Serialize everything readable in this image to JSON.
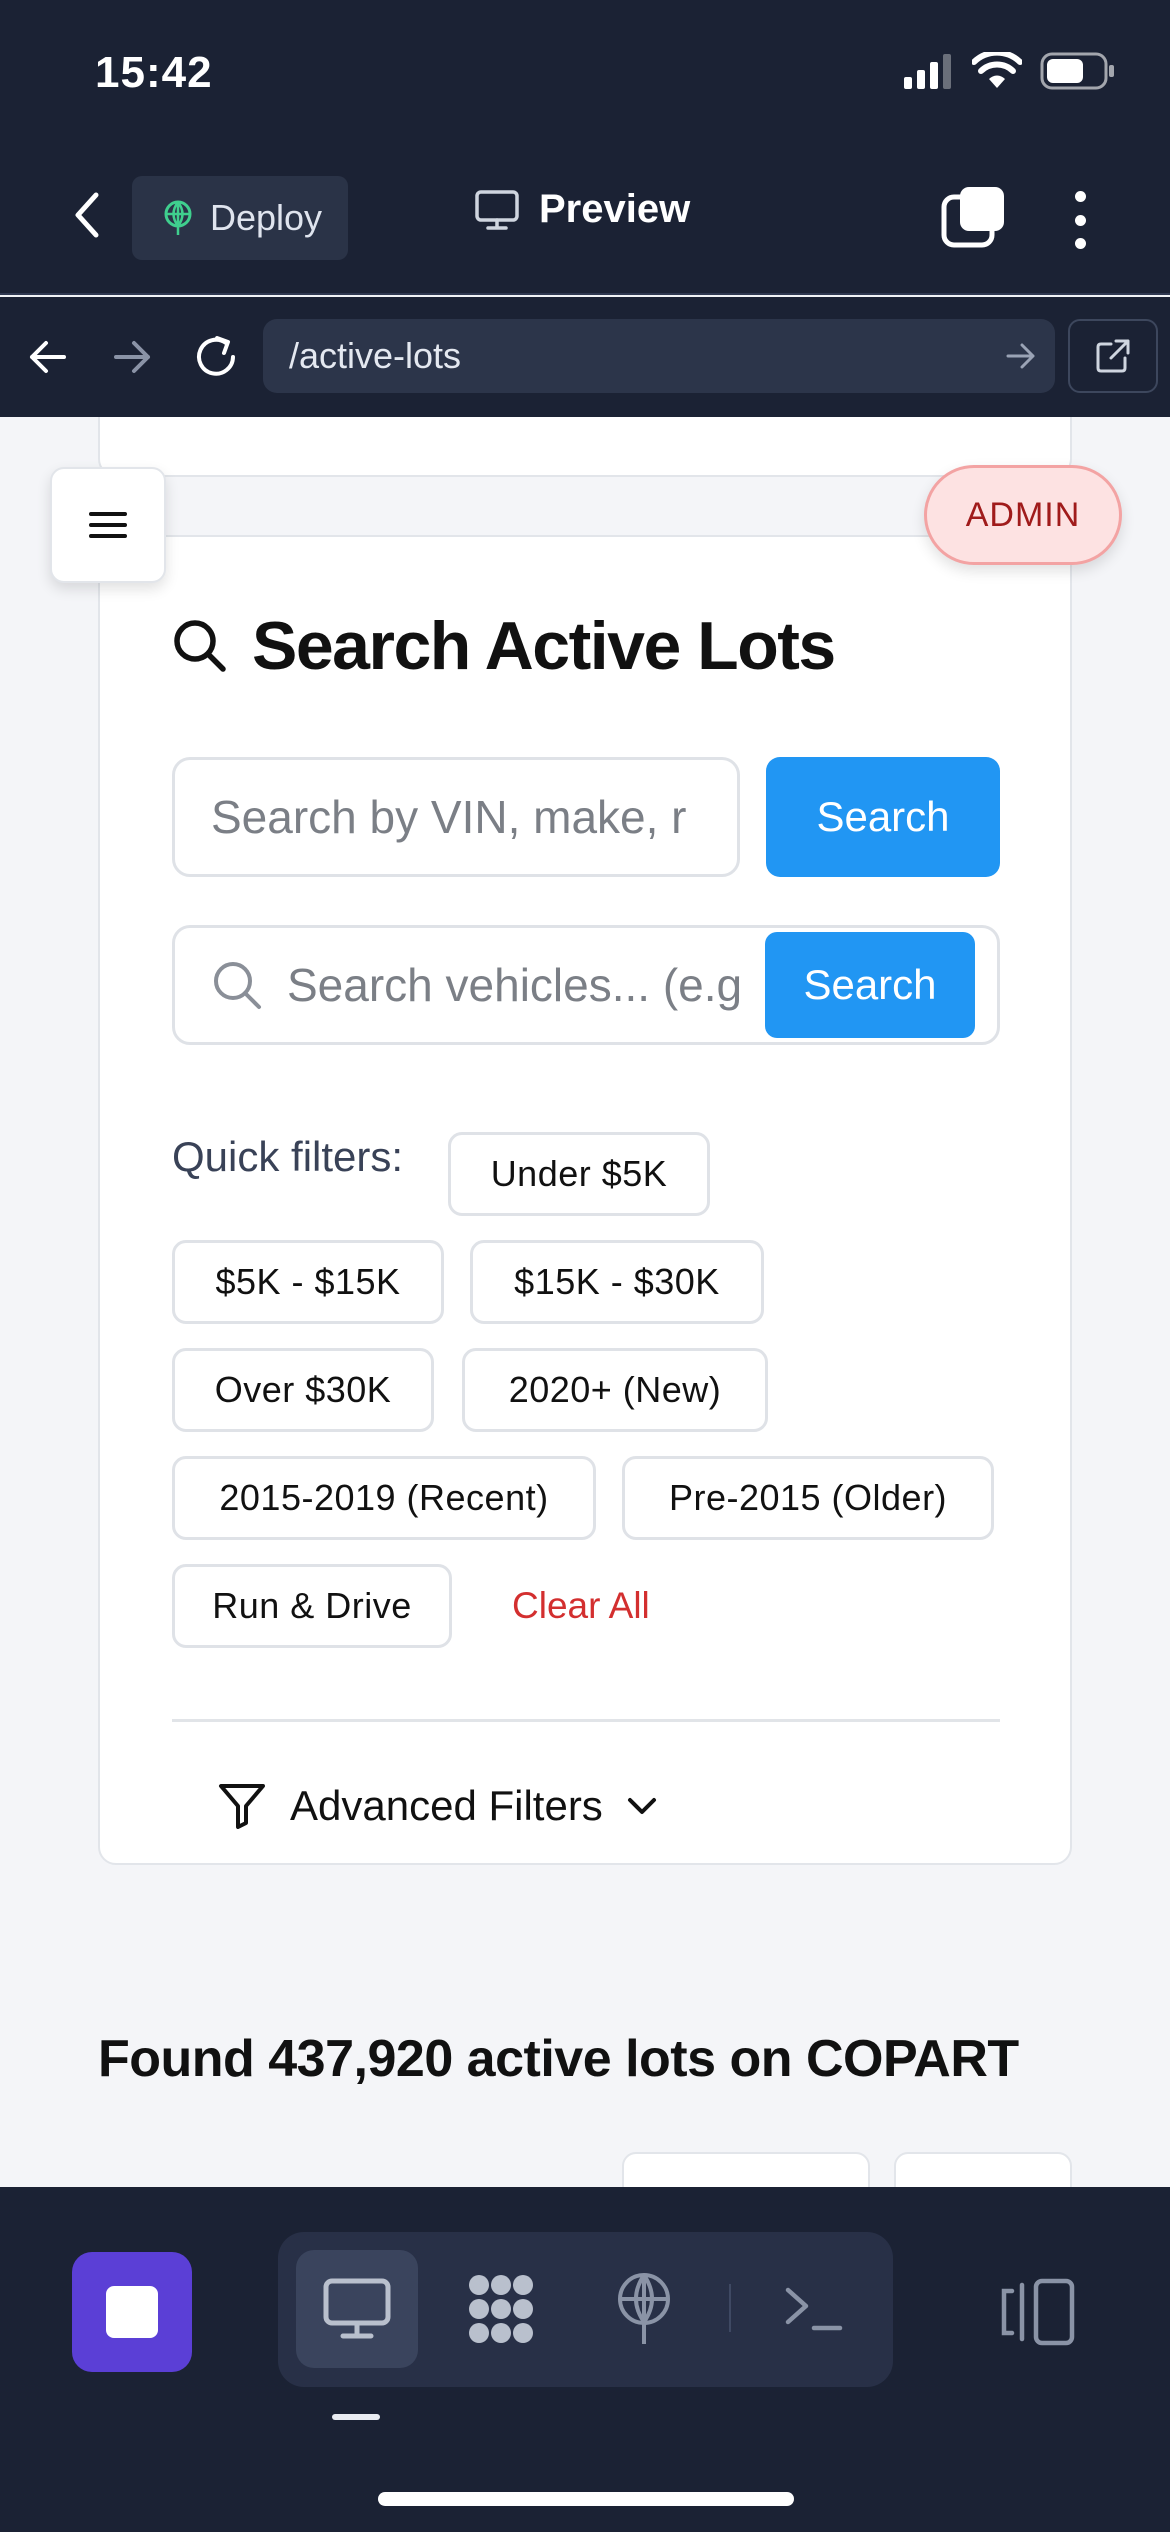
{
  "status_bar": {
    "time": "15:42"
  },
  "toolbar": {
    "deploy_label": "Deploy",
    "preview_label": "Preview"
  },
  "url_bar": {
    "url": "/active-lots"
  },
  "admin_badge": "ADMIN",
  "search_card": {
    "title": "Search Active Lots",
    "input1_placeholder": "Search by VIN, make, r",
    "search1_label": "Search",
    "input2_placeholder": "Search vehicles... (e.g",
    "search2_label": "Search",
    "quick_filters_label": "Quick filters:",
    "quick_filters": [
      "Under $5K",
      "$5K - $15K",
      "$15K - $30K",
      "Over $30K",
      "2020+ (New)",
      "2015-2019 (Recent)",
      "Pre-2015 (Older)",
      "Run & Drive"
    ],
    "clear_all": "Clear All",
    "advanced_filters": "Advanced Filters"
  },
  "results": {
    "found_text": "Found 437,920 active lots on COPART"
  },
  "colors": {
    "dark_chrome": "#1b2234",
    "primary_blue": "#2196f3",
    "stop_purple": "#5b3fd6",
    "admin_red": "#a01b1b",
    "clear_red": "#d32f2f",
    "deploy_green": "#3fcf8e"
  },
  "icons": {
    "status": [
      "signal-icon",
      "wifi-icon",
      "battery-icon"
    ],
    "toolbar": [
      "chevron-left-icon",
      "deploy-icon",
      "monitor-icon",
      "tabs-icon",
      "more-vertical-icon"
    ],
    "url_bar": [
      "arrow-left-icon",
      "arrow-right-icon",
      "reload-icon",
      "go-arrow-icon",
      "external-link-icon"
    ],
    "card": [
      "search-icon",
      "filter-icon",
      "chevron-down-icon"
    ],
    "bottom": [
      "stop-icon",
      "monitor-icon",
      "nodes-icon",
      "deploy-icon",
      "terminal-icon",
      "layout-icon"
    ]
  }
}
